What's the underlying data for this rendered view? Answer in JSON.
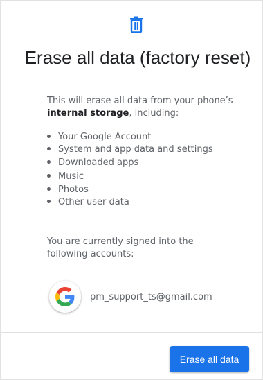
{
  "header": {
    "icon": "trash-icon",
    "title": "Erase all data (factory reset)"
  },
  "intro": {
    "text_before": "This will erase all data from your phone’s ",
    "bold_text": "internal storage",
    "text_after": ", including:"
  },
  "erase_items": [
    "Your Google Account",
    "System and app data and settings",
    "Downloaded apps",
    "Music",
    "Photos",
    "Other user data"
  ],
  "accounts": {
    "heading": "You are currently signed into the following accounts:",
    "items": [
      {
        "icon": "google-logo-icon",
        "email": "pm_support_ts@gmail.com"
      }
    ]
  },
  "footer": {
    "erase_button_label": "Erase all data"
  },
  "colors": {
    "accent": "#1a73e8",
    "title_text": "#202124",
    "body_text": "#5f6368"
  }
}
